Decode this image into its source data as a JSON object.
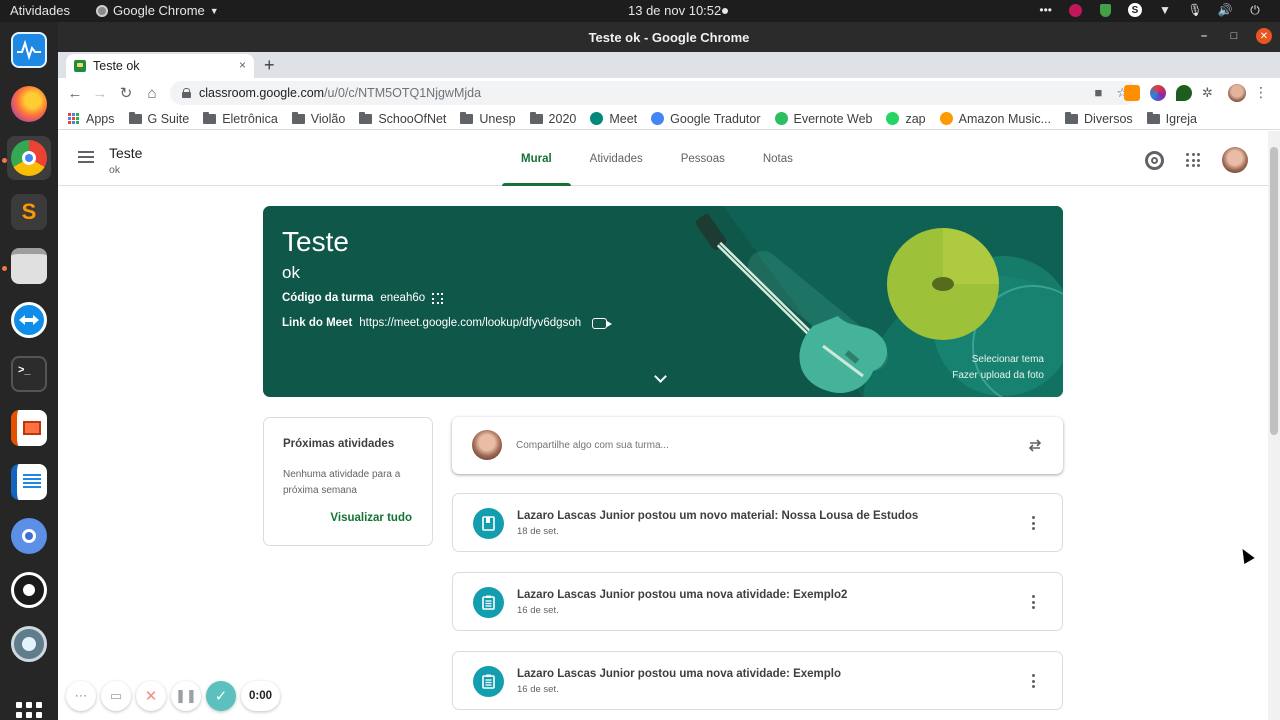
{
  "system": {
    "activities": "Atividades",
    "app_name": "Google Chrome",
    "clock": "13 de nov  10:52",
    "tray_more": "•••"
  },
  "window": {
    "title": "Teste ok - Google Chrome",
    "tab_title": "Teste ok",
    "tab_close": "×",
    "new_tab": "+",
    "url_host": "classroom.google.com",
    "url_path": "/u/0/c/NTM5OTQ1NjgwMjda"
  },
  "bookmarks": [
    {
      "label": "Apps",
      "icon": "apps-grid-icon"
    },
    {
      "label": "G Suite",
      "icon": "folder-icon"
    },
    {
      "label": "Eletrônica",
      "icon": "folder-icon"
    },
    {
      "label": "Violão",
      "icon": "folder-icon"
    },
    {
      "label": "SchooOfNet",
      "icon": "folder-icon"
    },
    {
      "label": "Unesp",
      "icon": "folder-icon"
    },
    {
      "label": "2020",
      "icon": "folder-icon"
    },
    {
      "label": "Meet",
      "icon": "meet-icon"
    },
    {
      "label": "Google Tradutor",
      "icon": "translate-icon"
    },
    {
      "label": "Evernote Web",
      "icon": "evernote-icon"
    },
    {
      "label": "zap",
      "icon": "whatsapp-icon"
    },
    {
      "label": "Amazon Music...",
      "icon": "amazon-icon"
    },
    {
      "label": "Diversos",
      "icon": "folder-icon"
    },
    {
      "label": "Igreja",
      "icon": "folder-icon"
    }
  ],
  "classroom": {
    "class_name": "Teste",
    "class_section": "ok",
    "tabs": [
      "Mural",
      "Atividades",
      "Pessoas",
      "Notas"
    ],
    "active_tab": "Mural",
    "banner": {
      "title": "Teste",
      "subtitle": "ok",
      "code_label": "Código da turma",
      "code_value": "eneah6o",
      "meet_label": "Link do Meet",
      "meet_value": "https://meet.google.com/lookup/dfyv6dgsoh",
      "select_theme": "Selecionar tema",
      "upload_photo": "Fazer upload da foto",
      "color": "#0e5749"
    },
    "upcoming": {
      "title": "Próximas atividades",
      "empty": "Nenhuma atividade para a próxima semana",
      "view_all": "Visualizar tudo"
    },
    "share_placeholder": "Compartilhe algo com sua turma...",
    "posts": [
      {
        "title": "Lazaro Lascas Junior postou um novo material: Nossa Lousa de Estudos",
        "date": "18 de set.",
        "icon": "material-icon"
      },
      {
        "title": "Lazaro Lascas Junior postou uma nova atividade: Exemplo2",
        "date": "16 de set.",
        "icon": "assignment-icon"
      },
      {
        "title": "Lazaro Lascas Junior postou uma nova atividade: Exemplo",
        "date": "16 de set.",
        "icon": "assignment-icon"
      }
    ],
    "accent_color": "#137333",
    "post_icon_color": "#129eaf"
  },
  "recorder": {
    "timer": "0:00"
  }
}
